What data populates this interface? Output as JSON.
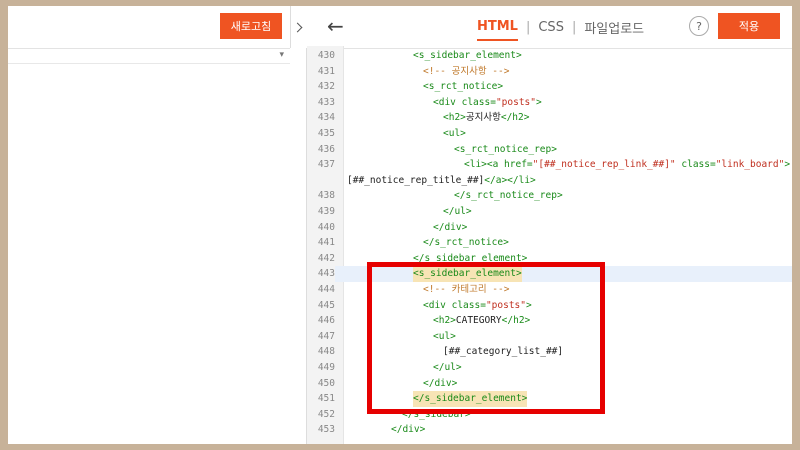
{
  "left_panel": {
    "refresh_label": "새로고침"
  },
  "header": {
    "tabs": [
      "HTML",
      "CSS",
      "파일업로드"
    ],
    "help_label": "?",
    "apply_label": "적용"
  },
  "code_lines": [
    {
      "n": "430",
      "segs": [
        [
          "tag",
          "<s_sidebar_element>"
        ]
      ],
      "indent": 72
    },
    {
      "n": "431",
      "segs": [
        [
          "cmt",
          "<!-- 공지사항 -->"
        ]
      ],
      "indent": 82
    },
    {
      "n": "432",
      "segs": [
        [
          "tag",
          "<s_rct_notice>"
        ]
      ],
      "indent": 82
    },
    {
      "n": "433",
      "segs": [
        [
          "tag",
          "<div "
        ],
        [
          "attr",
          "class="
        ],
        [
          "str",
          "\"posts\""
        ],
        [
          "tag",
          ">"
        ]
      ],
      "indent": 92
    },
    {
      "n": "434",
      "segs": [
        [
          "tag",
          "<h2>"
        ],
        [
          "plain",
          "공지사항"
        ],
        [
          "tag",
          "</h2>"
        ]
      ],
      "indent": 102
    },
    {
      "n": "435",
      "segs": [
        [
          "tag",
          "<ul>"
        ]
      ],
      "indent": 102
    },
    {
      "n": "436",
      "segs": [
        [
          "tag",
          "<s_rct_notice_rep>"
        ]
      ],
      "indent": 113
    },
    {
      "n": "437",
      "segs": [
        [
          "tag",
          "<li><a "
        ],
        [
          "attr",
          "href="
        ],
        [
          "str",
          "\"[##_notice_rep_link_##]\""
        ],
        [
          "attr",
          " class="
        ],
        [
          "str",
          "\"link_board\""
        ],
        [
          "tag",
          ">"
        ]
      ],
      "indent": 123
    },
    {
      "n": "",
      "segs": [
        [
          "plain",
          "[##_notice_rep_title_##]"
        ],
        [
          "tag",
          "</a></li>"
        ]
      ],
      "indent": 6
    },
    {
      "n": "438",
      "segs": [
        [
          "tag",
          "</s_rct_notice_rep>"
        ]
      ],
      "indent": 113
    },
    {
      "n": "439",
      "segs": [
        [
          "tag",
          "</ul>"
        ]
      ],
      "indent": 102
    },
    {
      "n": "440",
      "segs": [
        [
          "tag",
          "</div>"
        ]
      ],
      "indent": 92
    },
    {
      "n": "441",
      "segs": [
        [
          "tag",
          "</s_rct_notice>"
        ]
      ],
      "indent": 82
    },
    {
      "n": "442",
      "segs": [
        [
          "tag",
          "</s_sidebar_element>"
        ]
      ],
      "indent": 72
    },
    {
      "n": "443",
      "segs": [
        [
          "tag",
          "<s_sidebar_element>"
        ]
      ],
      "indent": 72,
      "hl": true,
      "match": true
    },
    {
      "n": "444",
      "segs": [
        [
          "cmt",
          "<!-- 카테고리 -->"
        ]
      ],
      "indent": 82
    },
    {
      "n": "445",
      "segs": [
        [
          "tag",
          "<div "
        ],
        [
          "attr",
          "class="
        ],
        [
          "str",
          "\"posts\""
        ],
        [
          "tag",
          ">"
        ]
      ],
      "indent": 82
    },
    {
      "n": "446",
      "segs": [
        [
          "tag",
          "<h2>"
        ],
        [
          "plain",
          "CATEGORY"
        ],
        [
          "tag",
          "</h2>"
        ]
      ],
      "indent": 92
    },
    {
      "n": "447",
      "segs": [
        [
          "tag",
          "<ul>"
        ]
      ],
      "indent": 92
    },
    {
      "n": "448",
      "segs": [
        [
          "plain",
          "[##_category_list_##]"
        ]
      ],
      "indent": 102
    },
    {
      "n": "449",
      "segs": [
        [
          "tag",
          "</ul>"
        ]
      ],
      "indent": 92
    },
    {
      "n": "450",
      "segs": [
        [
          "tag",
          "</div>"
        ]
      ],
      "indent": 82
    },
    {
      "n": "451",
      "segs": [
        [
          "tag",
          "</s_sidebar_element>"
        ]
      ],
      "indent": 72,
      "match": true
    },
    {
      "n": "452",
      "segs": [
        [
          "tag",
          "</s_sidebar>"
        ]
      ],
      "indent": 61
    },
    {
      "n": "453",
      "segs": [
        [
          "tag",
          "</div>"
        ]
      ],
      "indent": 50
    }
  ]
}
